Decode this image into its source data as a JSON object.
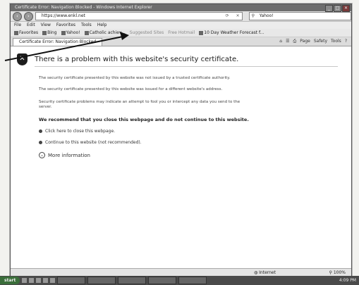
{
  "window": {
    "title": "Certificate Error: Navigation Blocked - Windows Internet Explorer",
    "controls": [
      "_",
      "□",
      "✕"
    ]
  },
  "address": {
    "back_icon": "back-arrow-icon",
    "forward_icon": "forward-arrow-icon",
    "url": "https://www.enkl.net",
    "search_value": "Yahoo!"
  },
  "menu": [
    "File",
    "Edit",
    "View",
    "Favorites",
    "Tools",
    "Help"
  ],
  "favorites": [
    {
      "label": "Favorites",
      "dim": false
    },
    {
      "label": "Bing",
      "dim": false
    },
    {
      "label": "Yahoo!",
      "dim": false
    },
    {
      "label": "Catholic achiev...",
      "dim": false
    },
    {
      "label": "Suggested Sites",
      "dim": true
    },
    {
      "label": "Free Hotmail",
      "dim": true
    },
    {
      "label": "10 Day Weather Forecast f...",
      "dim": false
    }
  ],
  "tab": {
    "label": "Certificate Error: Navigation Blocked"
  },
  "command_bar": [
    "Page",
    "Safety",
    "Tools"
  ],
  "error": {
    "heading": "There is a problem with this website's security certificate.",
    "p1": "The security certificate presented by this website was not issued by a trusted certificate authority.",
    "p2": "The security certificate presented by this website was issued for a different website's address.",
    "p3": "Security certificate problems may indicate an attempt to fool you or intercept any data you send to the server.",
    "recommend": "We recommend that you close this webpage and do not continue to this website.",
    "close_link": "Click here to close this webpage.",
    "continue_link": "Continue to this website (not recommended).",
    "more_info": "More information"
  },
  "status": {
    "zone": "Internet",
    "zoom": "100%"
  },
  "taskbar": {
    "start": "start",
    "clock": "4:09 PM"
  },
  "colors": {
    "title_bar": "#6d6d6d",
    "taskbar": "#4a4a4a",
    "start_button": "#3a6e3a"
  }
}
